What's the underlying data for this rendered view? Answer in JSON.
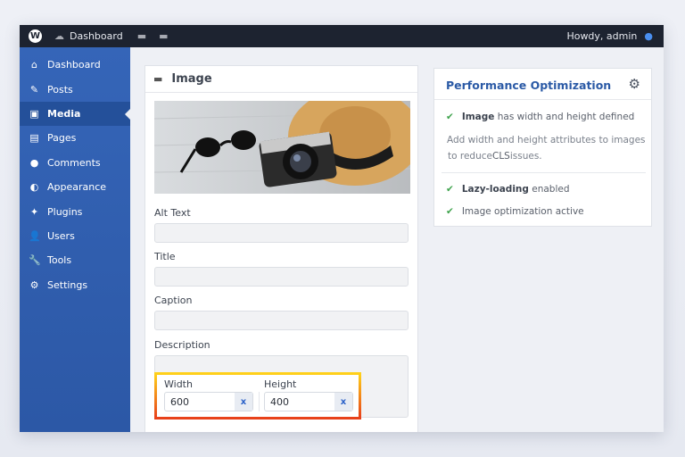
{
  "topbar": {
    "site": "Dashboard",
    "howdy": "Howdy, admin"
  },
  "sidebar": {
    "items": [
      {
        "label": "Dashboard",
        "icon": "⌂"
      },
      {
        "label": "Posts",
        "icon": "✎"
      },
      {
        "label": "Media",
        "icon": "▣"
      },
      {
        "label": "Pages",
        "icon": "▤"
      },
      {
        "label": "Comments",
        "icon": "●"
      },
      {
        "label": "Appearance",
        "icon": "◐"
      },
      {
        "label": "Plugins",
        "icon": "✦"
      },
      {
        "label": "Users",
        "icon": "👤"
      },
      {
        "label": "Tools",
        "icon": "🔧"
      },
      {
        "label": "Settings",
        "icon": "⚙"
      }
    ]
  },
  "image_panel": {
    "title": "Image",
    "alt_label": "Alt Text",
    "title_label": "Title",
    "caption_label": "Caption",
    "description_label": "Description",
    "width_label": "Width",
    "width_value": "600",
    "height_label": "Height",
    "height_value": "400",
    "clear": "x"
  },
  "perf": {
    "title": "Performance Optimization",
    "check1_bold": "Image",
    "check1_rest": " has width and height defined",
    "hint1": "Add width and height attributes to images",
    "hint2_a": "to reduce ",
    "hint2_b": "CLS",
    "hint2_c": " issues.",
    "check2_bold": "Lazy-loading",
    "check2_rest": " enabled",
    "check3": "Image optimization active"
  },
  "colors": {
    "accent": "#2b5aa6",
    "check": "#3fa34d",
    "highlight_top": "#ffd11a",
    "highlight_bottom": "#e8401a"
  }
}
